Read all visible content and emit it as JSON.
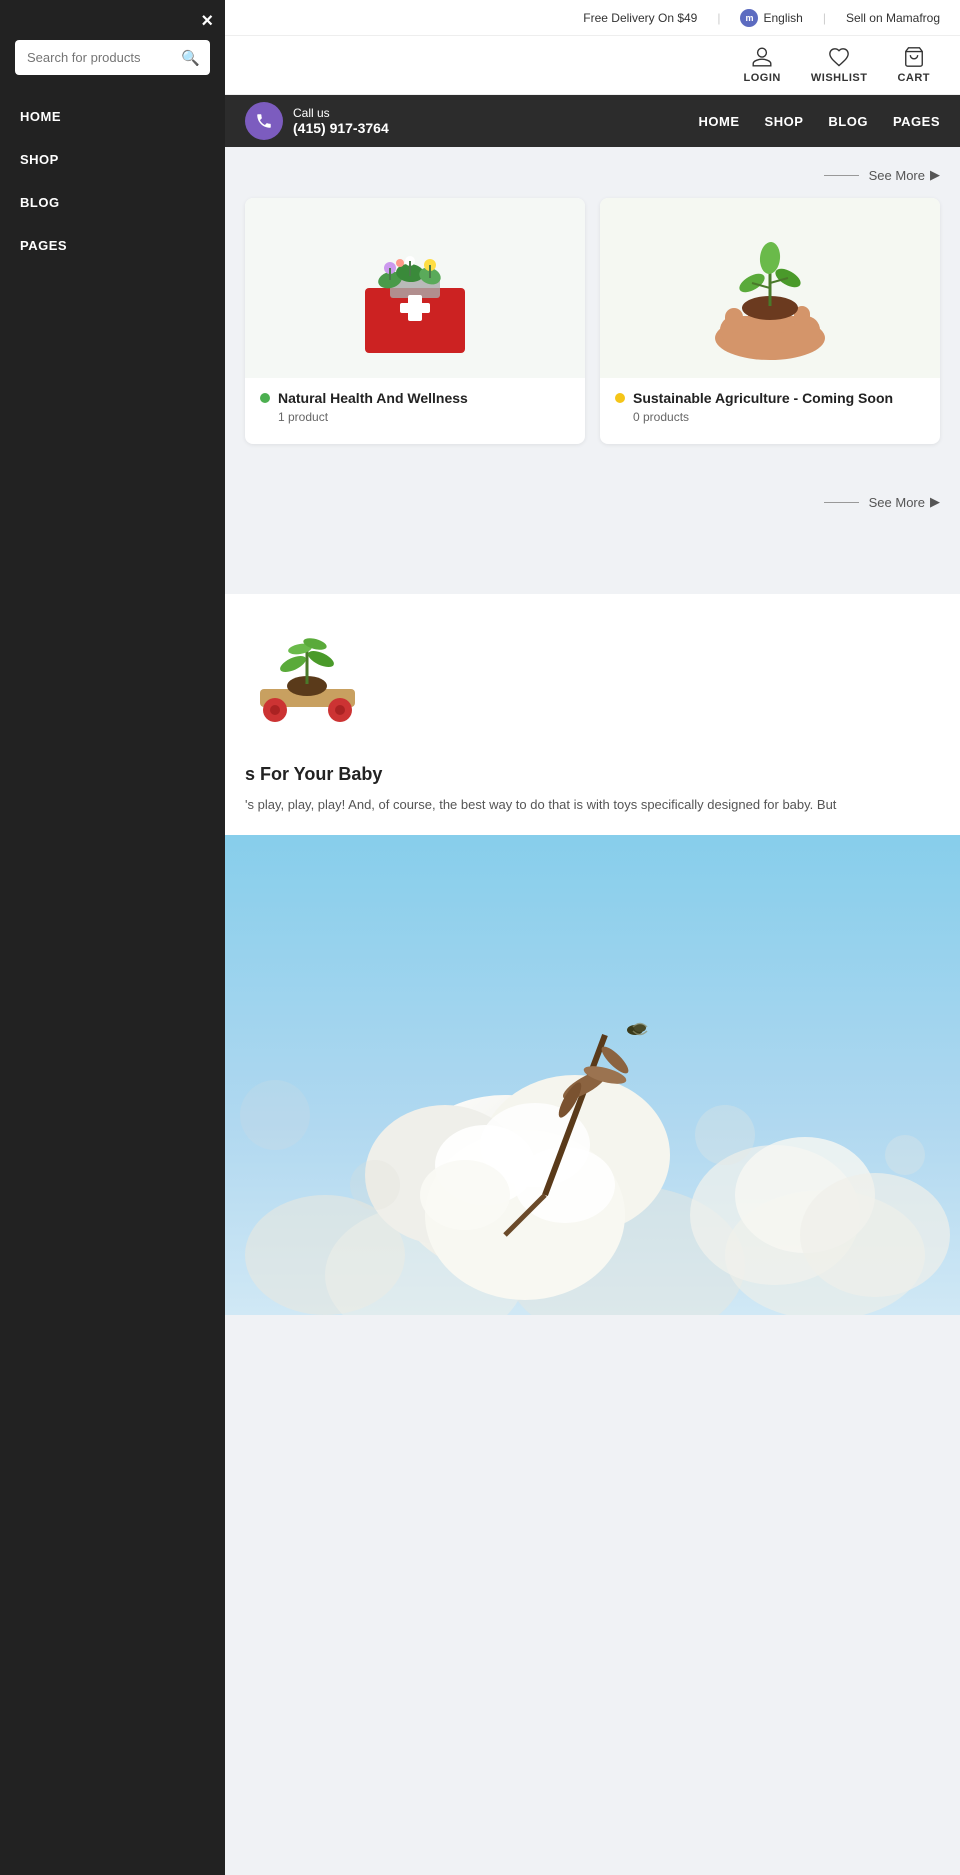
{
  "topbar": {
    "delivery": "Free Delivery On $49",
    "logo_alt": "m",
    "language": "English",
    "sell": "Sell on Mamafrog"
  },
  "header": {
    "login_label": "LOGIN",
    "wishlist_label": "WISHLIST",
    "cart_label": "CART"
  },
  "navbar": {
    "call_label": "Call us",
    "phone": "(415) 917-3764",
    "links": [
      "HOME",
      "SHOP",
      "BLOG",
      "PAGES"
    ]
  },
  "sidebar": {
    "close_label": "×",
    "search_placeholder": "Search for products",
    "nav_items": [
      "HOME",
      "SHOP",
      "BLOG",
      "PAGES"
    ]
  },
  "section1": {
    "see_more": "See More"
  },
  "categories": [
    {
      "name": "Natural Health And Wellness",
      "count": "1 product",
      "dot_color": "green"
    },
    {
      "name": "Sustainable Agriculture - Coming Soon",
      "count": "0 products",
      "dot_color": "yellow"
    }
  ],
  "section2": {
    "see_more": "See More"
  },
  "blog": {
    "title": "s For Your Baby",
    "excerpt": "'s play, play, play! And, of course, the best way to do that is with toys specifically designed for baby. But"
  }
}
